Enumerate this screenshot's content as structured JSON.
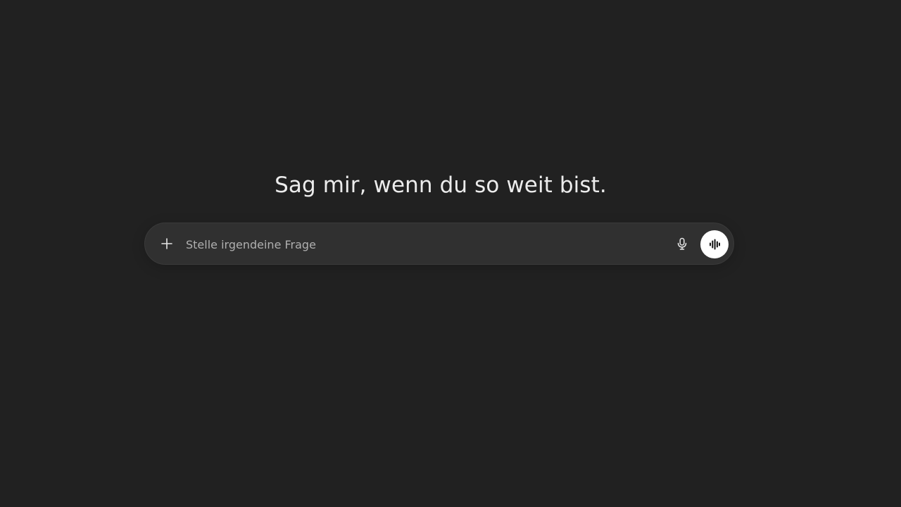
{
  "main": {
    "headline": "Sag mir, wenn du so weit bist."
  },
  "composer": {
    "placeholder": "Stelle irgendeine Frage",
    "value": "",
    "icons": {
      "attach": "plus-icon",
      "dictate": "microphone-icon",
      "voice_mode": "sound-wave-icon"
    }
  },
  "colors": {
    "background": "#212121",
    "composer_background": "#303030",
    "text": "#ececec",
    "placeholder": "#afafaf",
    "voice_button": "#ffffff"
  }
}
